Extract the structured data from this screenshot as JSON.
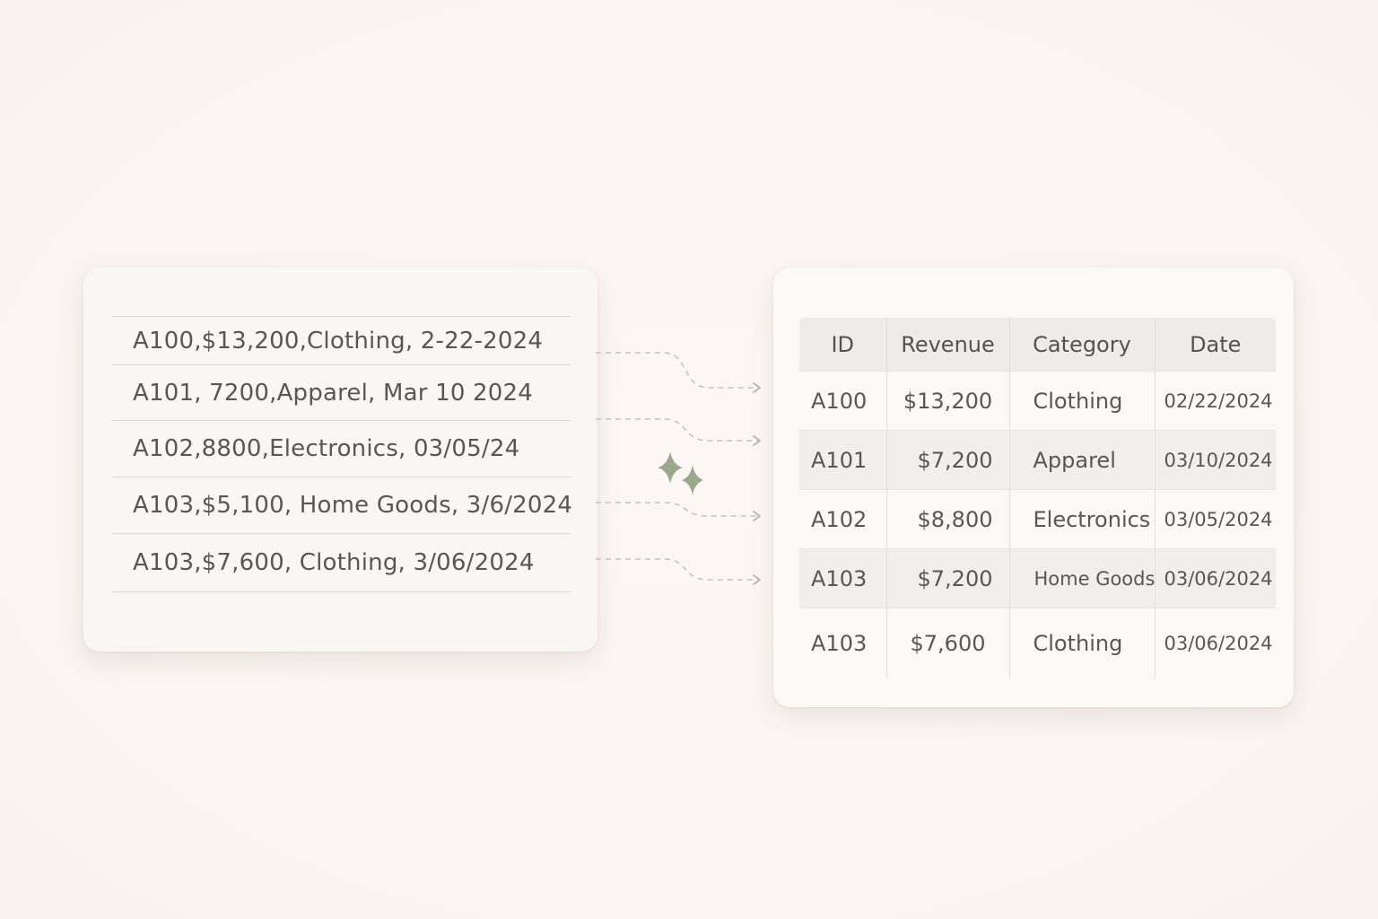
{
  "raw_records": [
    "A100,$13,200,Clothing, 2-22-2024",
    "A101, 7200,Apparel, Mar 10 2024",
    "A102,8800,Electronics, 03/05/24",
    "A103,$5,100, Home Goods, 3/6/2024",
    "A103,$7,600, Clothing, 3/06/2024"
  ],
  "table": {
    "headers": [
      "ID",
      "Revenue",
      "Category",
      "Date"
    ],
    "rows": [
      [
        "A100",
        "$13,200",
        "Clothing",
        "02/22/2024"
      ],
      [
        "A101",
        "$7,200",
        "Apparel",
        "03/10/2024"
      ],
      [
        "A102",
        "$8,800",
        "Electronics",
        "03/05/2024"
      ],
      [
        "A103",
        "$7,200",
        "Home Goods",
        "03/06/2024"
      ],
      [
        "A103",
        "$7,600",
        "Clothing",
        "03/06/2024"
      ]
    ]
  },
  "icons": {
    "transform": "sparkle-icon",
    "connector_end": "arrow-icon"
  },
  "colors": {
    "background": "#fbf5f3",
    "card": "#faf6f3",
    "text": "#5b5654",
    "header_fill": "#efebe8",
    "stripe_fill": "#f1eeec",
    "sparkle": "#9aa98e",
    "connector": "#c9c1bd"
  }
}
